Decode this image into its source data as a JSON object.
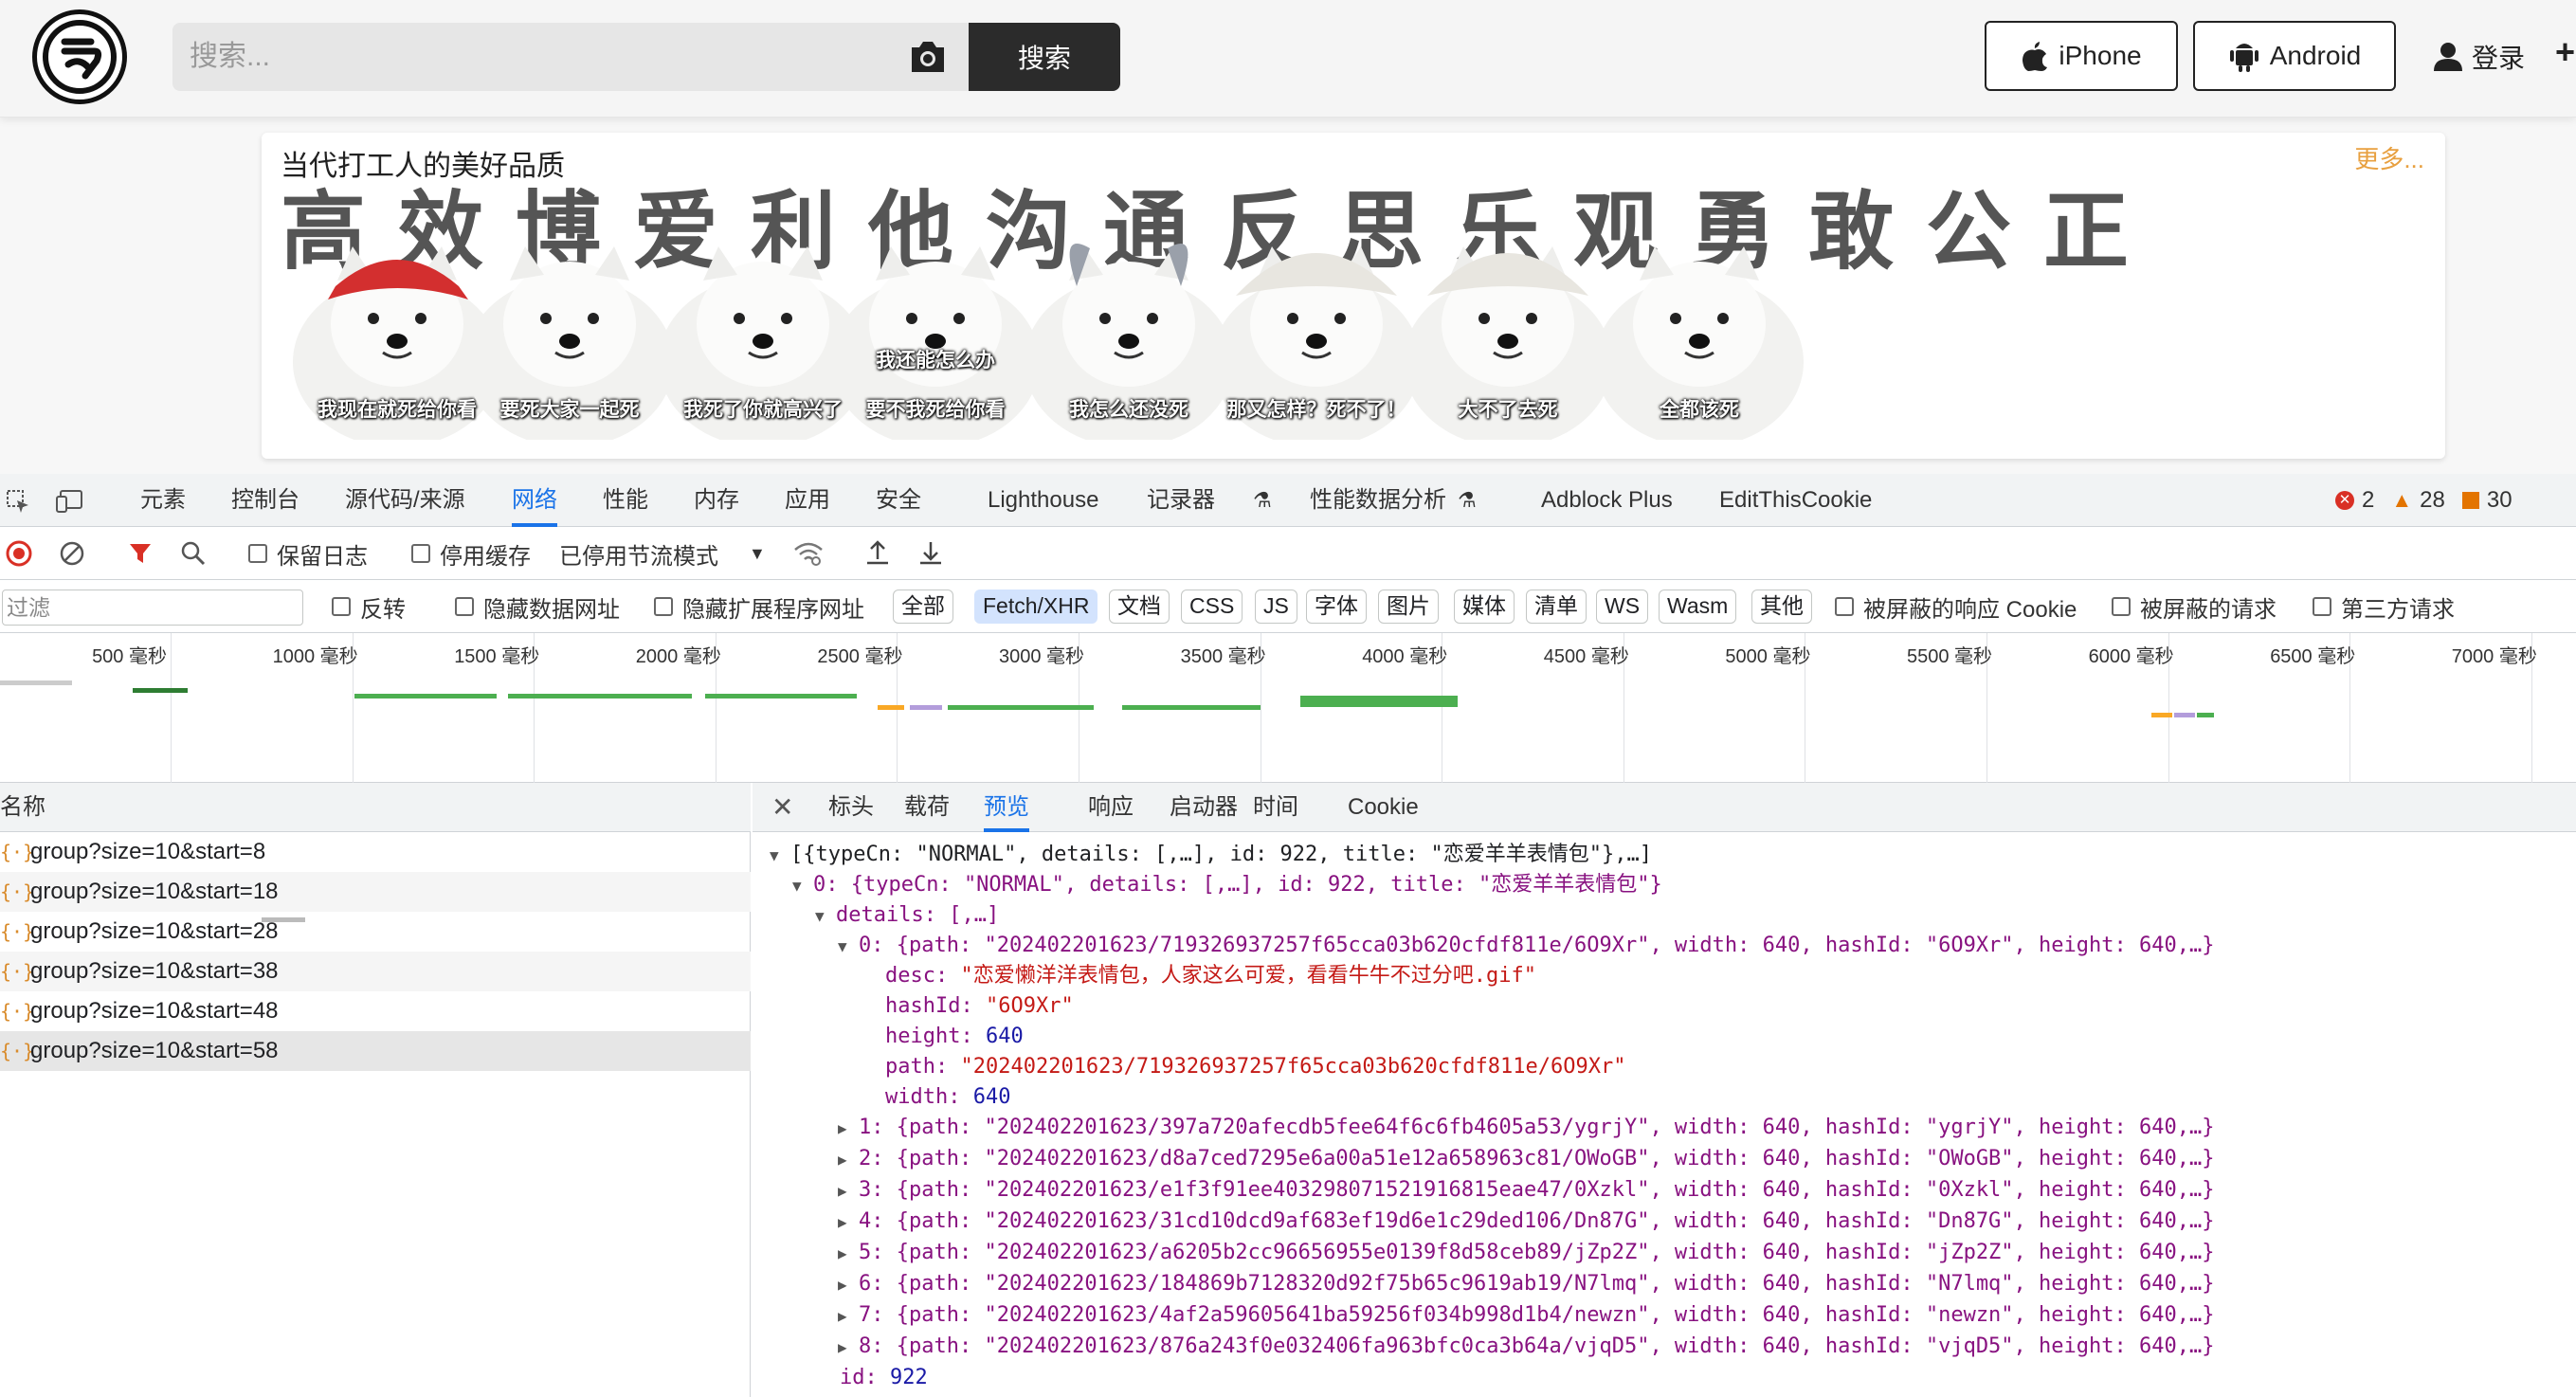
{
  "site": {
    "search_placeholder": "搜索...",
    "search_button": "搜索",
    "iphone": "iPhone",
    "android": "Android",
    "login": "登录",
    "plus": "+",
    "card_title": "当代打工人的美好品质",
    "card_more": "更多...",
    "big_text": "高效博爱利他沟通反思乐观勇敢公正",
    "memes": [
      {
        "caption": "我现在就死给你看"
      },
      {
        "caption": "要死大家一起死"
      },
      {
        "caption": "我死了你就高兴了"
      },
      {
        "caption_top": "我还能怎么办",
        "caption": "要不我死给你看"
      },
      {
        "caption": "我怎么还没死"
      },
      {
        "caption": "那又怎样？死不了！"
      },
      {
        "caption": "大不了去死"
      },
      {
        "caption": "全都该死"
      }
    ]
  },
  "devtools": {
    "tabs": [
      "元素",
      "控制台",
      "源代码/来源",
      "网络",
      "性能",
      "内存",
      "应用",
      "安全",
      "Lighthouse",
      "记录器",
      "性能数据分析",
      "Adblock Plus",
      "EditThisCookie"
    ],
    "active_tab": "网络",
    "errors": "2",
    "warnings": "28",
    "info": "30",
    "toolbar": {
      "preserve_log": "保留日志",
      "disable_cache": "停用缓存",
      "throttle": "已停用节流模式"
    },
    "filter": {
      "placeholder": "过滤",
      "invert": "反转",
      "hide_data_urls": "隐藏数据网址",
      "hide_ext_urls": "隐藏扩展程序网址",
      "types": [
        "全部",
        "Fetch/XHR",
        "文档",
        "CSS",
        "JS",
        "字体",
        "图片",
        "媒体",
        "清单",
        "WS",
        "Wasm",
        "其他"
      ],
      "active_type": "Fetch/XHR",
      "blocked_cookies": "被屏蔽的响应 Cookie",
      "blocked_requests": "被屏蔽的请求",
      "third_party": "第三方请求"
    },
    "timeline_ticks": [
      "500 毫秒",
      "1000 毫秒",
      "1500 毫秒",
      "2000 毫秒",
      "2500 毫秒",
      "3000 毫秒",
      "3500 毫秒",
      "4000 毫秒",
      "4500 毫秒",
      "5000 毫秒",
      "5500 毫秒",
      "6000 毫秒",
      "6500 毫秒",
      "7000 毫秒"
    ],
    "name_header": "名称",
    "requests": [
      "group?size=10&start=8",
      "group?size=10&start=18",
      "group?size=10&start=28",
      "group?size=10&start=38",
      "group?size=10&start=48",
      "group?size=10&start=58"
    ],
    "detail_tabs": [
      "标头",
      "载荷",
      "预览",
      "响应",
      "启动器",
      "时间",
      "Cookie"
    ],
    "active_detail_tab": "预览",
    "preview": {
      "root": "[{typeCn: \"NORMAL\", details: [,…], id: 922, title: \"恋爱羊羊表情包\"},…]",
      "item0": "0: {typeCn: \"NORMAL\", details: [,…], id: 922, title: \"恋爱羊羊表情包\"}",
      "details": "details: [,…]",
      "detail0": "0: {path: \"202402201623/719326937257f65cca03b620cfdf811e/6O9Xr\", width: 640, hashId: \"6O9Xr\", height: 640,…}",
      "desc_key": "desc:",
      "desc_val": "\"恋爱懒洋洋表情包，人家这么可爱，看看牛牛不过分吧.gif\"",
      "hashId_key": "hashId:",
      "hashId_val": "\"6O9Xr\"",
      "height_key": "height:",
      "height_val": "640",
      "path_key": "path:",
      "path_val": "\"202402201623/719326937257f65cca03b620cfdf811e/6O9Xr\"",
      "width_key": "width:",
      "width_val": "640",
      "rows": [
        "1: {path: \"202402201623/397a720afecdb5fee64f6c6fb4605a53/ygrjY\", width: 640, hashId: \"ygrjY\", height: 640,…}",
        "2: {path: \"202402201623/d8a7ced7295e6a00a51e12a658963c81/OWoGB\", width: 640, hashId: \"OWoGB\", height: 640,…}",
        "3: {path: \"202402201623/e1f3f91ee403298071521916815eae47/0Xzkl\", width: 640, hashId: \"0Xzkl\", height: 640,…}",
        "4: {path: \"202402201623/31cd10dcd9af683ef19d6e1c29ded106/Dn87G\", width: 640, hashId: \"Dn87G\", height: 640,…}",
        "5: {path: \"202402201623/a6205b2cc96656955e0139f8d58ceb89/jZp2Z\", width: 640, hashId: \"jZp2Z\", height: 640,…}",
        "6: {path: \"202402201623/184869b7128320d92f75b65c9619ab19/N7lmq\", width: 640, hashId: \"N7lmq\", height: 640,…}",
        "7: {path: \"202402201623/4af2a59605641ba59256f034b998d1b4/newzn\", width: 640, hashId: \"newzn\", height: 640,…}",
        "8: {path: \"202402201623/876a243f0e032406fa963bfc0ca3b64a/vjqD5\", width: 640, hashId: \"vjqD5\", height: 640,…}"
      ],
      "id_key": "id:",
      "id_val": "922"
    }
  }
}
